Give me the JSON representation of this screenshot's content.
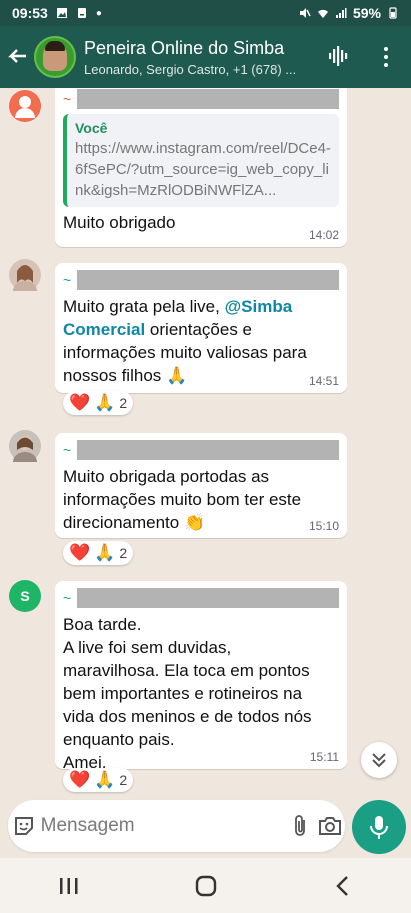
{
  "status": {
    "time": "09:53",
    "battery": "59%"
  },
  "header": {
    "title": "Peneira Online do Simba",
    "subtitle": "Leonardo, Sergio Castro, +1 (678) ..."
  },
  "messages": [
    {
      "sender_prefix": "~",
      "quote_name": "Você",
      "quote_text": "https://www.instagram.com/reel/DCe4-6fSePC/?utm_source=ig_web_copy_link&igsh=MzRlODBiNWFlZA...",
      "text": "Muito obrigado",
      "time": "14:02"
    },
    {
      "sender_prefix": "~",
      "text_before": "Muito grata pela live, ",
      "mention": "@Simba Comercial",
      "text_after": " orientações e informações muito valiosas para nossos filhos 🙏",
      "time": "14:51",
      "reaction_count": "2"
    },
    {
      "sender_prefix": "~",
      "text": "Muito obrigada portodas as informações muito bom ter este direcionamento 👏",
      "time": "15:10",
      "reaction_count": "2"
    },
    {
      "sender_prefix": "~",
      "avatar_letter": "S",
      "text": "Boa tarde.\nA live foi sem duvidas, maravilhosa. Ela toca em pontos bem importantes e rotineiros na vida dos meninos e de todos nós enquanto pais.\nAmei.",
      "time": "15:11",
      "reaction_count": "2"
    }
  ],
  "reactions": {
    "heart": "❤️",
    "pray": "🙏"
  },
  "input": {
    "placeholder": "Mensagem"
  },
  "colors": {
    "header": "#1f5a50",
    "accent": "#1a9e84",
    "chat_bg": "#efe7de"
  }
}
